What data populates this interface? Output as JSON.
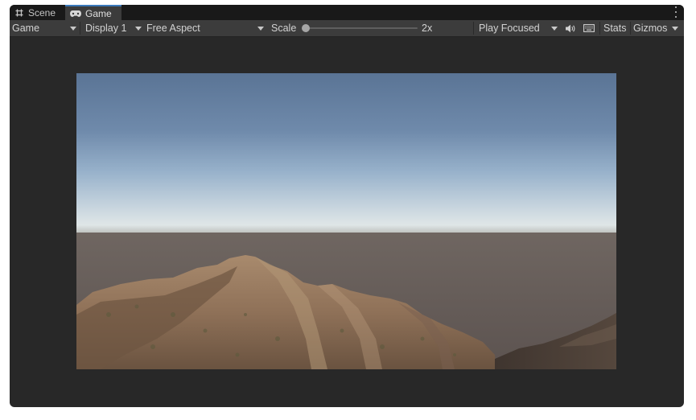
{
  "tabs": [
    {
      "label": "Scene",
      "icon": "grid-icon",
      "active": false
    },
    {
      "label": "Game",
      "icon": "gamepad-icon",
      "active": true
    }
  ],
  "toolbar": {
    "view_mode": "Game",
    "display": "Display 1",
    "aspect": "Free Aspect",
    "scale_label": "Scale",
    "scale_value": "2x",
    "play_mode": "Play Focused",
    "stats_label": "Stats",
    "gizmos_label": "Gizmos"
  },
  "colors": {
    "accent": "#3a79bb",
    "panel": "#282828",
    "toolbar": "#3c3c3c"
  }
}
